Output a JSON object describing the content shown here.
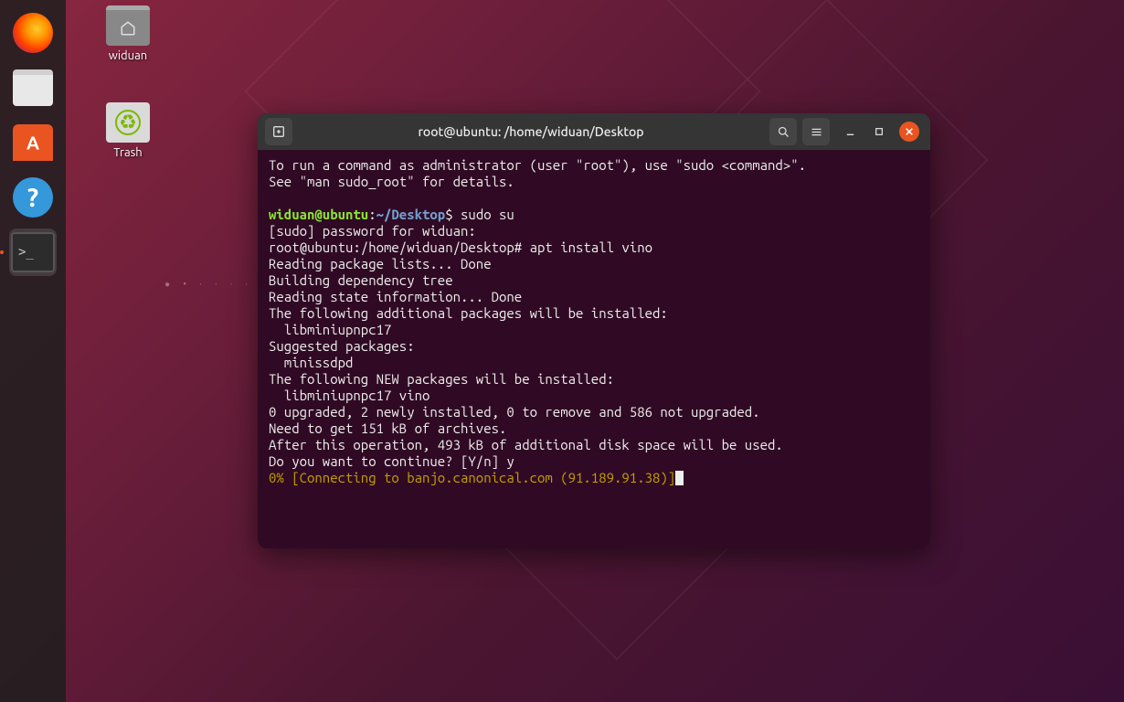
{
  "desktop": {
    "home_folder_label": "widuan",
    "trash_label": "Trash"
  },
  "dock": {
    "items": [
      {
        "name": "firefox"
      },
      {
        "name": "files"
      },
      {
        "name": "software"
      },
      {
        "name": "help"
      },
      {
        "name": "terminal"
      }
    ]
  },
  "terminal": {
    "title": "root@ubuntu: /home/widuan/Desktop",
    "sudo_hint_line1": "To run a command as administrator (user \"root\"), use \"sudo <command>\".",
    "sudo_hint_line2": "See \"man sudo_root\" for details.",
    "prompt_user": "widuan@ubuntu",
    "prompt_colon": ":",
    "prompt_path": "~/Desktop",
    "prompt_dollar": "$ ",
    "cmd1": "sudo su",
    "line_sudo_pwd": "[sudo] password for widuan:",
    "root_prompt": "root@ubuntu:/home/widuan/Desktop# ",
    "cmd2": "apt install vino",
    "out_reading": "Reading package lists... Done",
    "out_building": "Building dependency tree",
    "out_state": "Reading state information... Done",
    "out_additional": "The following additional packages will be installed:",
    "out_additional_pkgs": "  libminiupnpc17",
    "out_suggested": "Suggested packages:",
    "out_suggested_pkgs": "  minissdpd",
    "out_new": "The following NEW packages will be installed:",
    "out_new_pkgs": "  libminiupnpc17 vino",
    "out_summary": "0 upgraded, 2 newly installed, 0 to remove and 586 not upgraded.",
    "out_need": "Need to get 151 kB of archives.",
    "out_after": "After this operation, 493 kB of additional disk space will be used.",
    "out_continue": "Do you want to continue? [Y/n] ",
    "answer": "y",
    "progress": "0% [Connecting to banjo.canonical.com (91.189.91.38)]"
  }
}
